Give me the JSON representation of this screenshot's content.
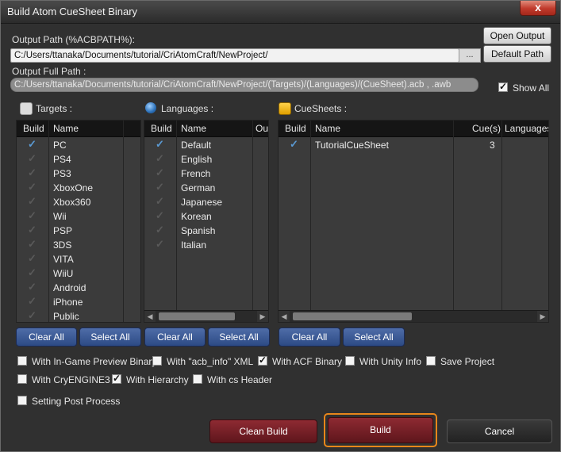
{
  "window": {
    "title": "Build Atom CueSheet Binary",
    "close_glyph": "x"
  },
  "output": {
    "path_label": "Output Path (%ACBPATH%):",
    "path_value": "C:/Users/ttanaka/Documents/tutorial/CriAtomCraft/NewProject/",
    "browse_label": "...",
    "full_path_label": "Output Full Path :",
    "full_path_value": "C:/Users/ttanaka/Documents/tutorial/CriAtomCraft/NewProject/(Targets)/(Languages)/(CueSheet).acb , .awb",
    "open_output_label": "Open Output",
    "default_path_label": "Default Path",
    "show_all_label": "Show All",
    "show_all_checked": true
  },
  "targets": {
    "title": "Targets :",
    "icon": "targets-icon",
    "headers": [
      "Build",
      "Name"
    ],
    "rows": [
      {
        "name": "PC",
        "checked": true
      },
      {
        "name": "PS4",
        "checked": false
      },
      {
        "name": "PS3",
        "checked": false
      },
      {
        "name": "XboxOne",
        "checked": false
      },
      {
        "name": "Xbox360",
        "checked": false
      },
      {
        "name": "Wii",
        "checked": false
      },
      {
        "name": "PSP",
        "checked": false
      },
      {
        "name": "3DS",
        "checked": false
      },
      {
        "name": "VITA",
        "checked": false
      },
      {
        "name": "WiiU",
        "checked": false
      },
      {
        "name": "Android",
        "checked": false
      },
      {
        "name": "iPhone",
        "checked": false
      },
      {
        "name": "Public",
        "checked": false
      }
    ],
    "clear_label": "Clear All",
    "select_label": "Select All"
  },
  "languages": {
    "title": "Languages :",
    "icon": "globe-icon",
    "headers": [
      "Build",
      "Name",
      "Ou"
    ],
    "rows": [
      {
        "name": "Default",
        "checked": true
      },
      {
        "name": "English",
        "checked": false
      },
      {
        "name": "French",
        "checked": false
      },
      {
        "name": "German",
        "checked": false
      },
      {
        "name": "Japanese",
        "checked": false
      },
      {
        "name": "Korean",
        "checked": false
      },
      {
        "name": "Spanish",
        "checked": false
      },
      {
        "name": "Italian",
        "checked": false
      }
    ],
    "clear_label": "Clear All",
    "select_label": "Select All"
  },
  "cuesheets": {
    "title": "CueSheets :",
    "icon": "cuesheet-icon",
    "headers": [
      "Build",
      "Name",
      "Cue(s)",
      "Languages"
    ],
    "rows": [
      {
        "name": "TutorialCueSheet",
        "cues": "3",
        "checked": true
      }
    ],
    "clear_label": "Clear All",
    "select_label": "Select All"
  },
  "options": [
    {
      "label": "With In-Game Preview Binary",
      "checked": false
    },
    {
      "label": "With \"acb_info\" XML",
      "checked": false
    },
    {
      "label": "With ACF Binary",
      "checked": true
    },
    {
      "label": "With Unity Info",
      "checked": false
    },
    {
      "label": "Save Project",
      "checked": false
    },
    {
      "label": "With CryENGINE3",
      "checked": false
    },
    {
      "label": "With Hierarchy",
      "checked": true
    },
    {
      "label": "With cs Header",
      "checked": false
    },
    {
      "label": "Setting Post Process",
      "checked": false
    }
  ],
  "actions": {
    "clean_build_label": "Clean Build",
    "build_label": "Build",
    "cancel_label": "Cancel"
  },
  "colors": {
    "accent_blue": "#5b9bd5",
    "build_red": "#8e2a32",
    "focus_orange": "#e8861a"
  }
}
